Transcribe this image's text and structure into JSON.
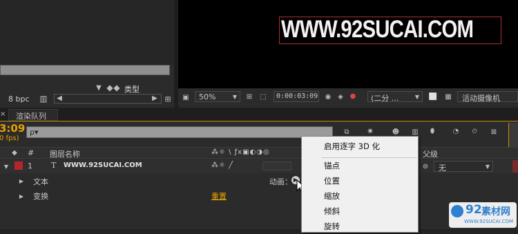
{
  "project_panel": {
    "bpc": "8 bpc",
    "type_label": "类型"
  },
  "comp_viewer": {
    "text": "WWW.92SUCAI.COM",
    "zoom": "50%",
    "timecode": "0:00:03:09",
    "resolution": "(二分 ...",
    "camera": "活动摄像机"
  },
  "timeline": {
    "tab_render_queue": "渲染队列",
    "current_time": "3:09",
    "fps": "0 fps)",
    "search_placeholder": "ρ▾",
    "col_hash": "#",
    "col_layer_name": "图层名称",
    "col_parent": "父级",
    "layer": {
      "number": "1",
      "type_icon": "T",
      "name": "WWW.92SUCAI.COM",
      "parent": "无"
    },
    "sub_text": "文本",
    "sub_transform": "变换",
    "reset": "重置",
    "animate": "动画："
  },
  "context_menu": {
    "items": [
      "启用逐字 3D 化",
      "锚点",
      "位置",
      "缩放",
      "倾斜",
      "旋转"
    ]
  },
  "watermark": {
    "number": "92",
    "label": "素材网",
    "url": "WWW.92SUCAI.COM"
  },
  "colors": {
    "accent_orange": "#e8a100",
    "layer_label_red": "#b5262a",
    "menu_bg": "#f0f0f0"
  }
}
